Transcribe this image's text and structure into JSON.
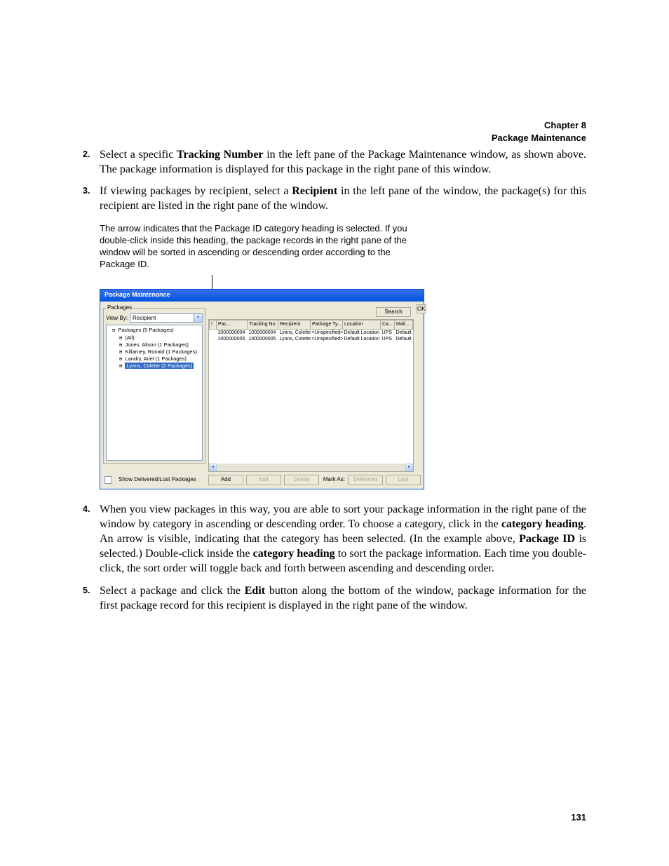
{
  "header": {
    "chapter": "Chapter 8",
    "title": "Package Maintenance"
  },
  "steps": {
    "s2_num": "2.",
    "s2_a": "Select a specific ",
    "s2_b": "Tracking Number",
    "s2_c": " in the left pane of the Package Maintenance window, as shown above. The package information is displayed for this package in the right pane of this window.",
    "s3_num": "3.",
    "s3_a": "If viewing packages by recipient, select a ",
    "s3_b": "Recipient",
    "s3_c": " in the left pane of the window, the package(s) for this recipient are listed in the right pane of the window.",
    "s4_num": "4.",
    "s4_a": "When you view packages in this way, you are able to sort your package information in the right pane of the window by category in ascending or descending order. To choose a category, click in the ",
    "s4_b": "category heading",
    "s4_c": ". An arrow is visible, indicating that the category has been selected. (In the example above, ",
    "s4_d": "Package ID",
    "s4_e": " is selected.) Double-click inside the ",
    "s4_f": "category heading",
    "s4_g": " to sort the package information. Each time you double-click, the sort order will toggle back and forth between ascending and descending order.",
    "s5_num": "5.",
    "s5_a": "Select a package and click the ",
    "s5_b": "Edit",
    "s5_c": " button along the bottom of the window, package information for the first package record for this recipient is displayed in the right pane of the window."
  },
  "callout": "The arrow indicates that the Package ID category heading is selected. If you double-click inside this heading, the package records in the right pane of the window will be sorted in ascending or descending order according to the Package ID.",
  "screenshot": {
    "title": "Package Maintenance",
    "packages_legend": "Packages",
    "viewby_label": "View By:",
    "viewby_value": "Recipient",
    "search_btn": "Search",
    "ok_btn": "OK",
    "tree": {
      "root": "Packages (5 Packages)",
      "all": "(All)",
      "r1": "Jones, Alison (1 Packages)",
      "r2": "Killarney, Ronald (1 Packages)",
      "r3": "Landry, Ariel (1 Packages)",
      "r4": "Lyons, Colette (2 Packages)"
    },
    "grid": {
      "headers": {
        "h0": "!",
        "h1": "Pac...",
        "h2": "Tracking No.",
        "h3": "Recipient",
        "h4": "Package Ty...",
        "h5": "Location",
        "h6": "Ca...",
        "h7": "Mail..."
      },
      "rows": [
        {
          "c0": "",
          "c1": "1000000004",
          "c2": "1000000004",
          "c3": "Lyons, Colette",
          "c4": "<Unspecified>",
          "c5": "Default Location",
          "c6": "UPS",
          "c7": "Default"
        },
        {
          "c0": "",
          "c1": "1000000005",
          "c2": "1000000005",
          "c3": "Lyons, Colette",
          "c4": "<Unspecified>",
          "c5": "Default Location",
          "c6": "UPS",
          "c7": "Default"
        }
      ]
    },
    "show_delivered": "Show Delivered/Lost Packages",
    "btns": {
      "add": "Add",
      "edit": "Edit",
      "delete": "Delete",
      "markas": "Mark As:",
      "delivered": "Delivered",
      "lost": "Lost"
    }
  },
  "page_number": "131"
}
